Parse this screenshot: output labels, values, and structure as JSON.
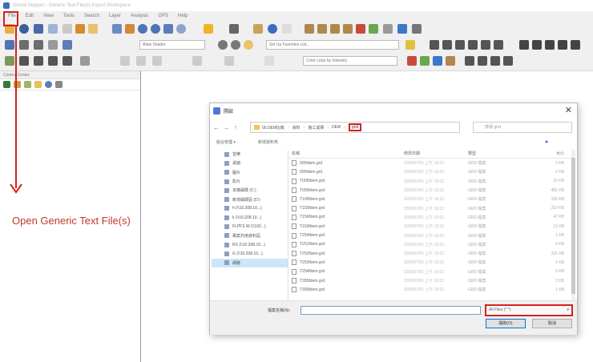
{
  "app": {
    "title": "Global Mapper - Generic Text File(s) Import Workspace"
  },
  "menu": [
    "File",
    "Edit",
    "View",
    "Tools",
    "Search",
    "Layer",
    "Analysis",
    "GPS",
    "Help"
  ],
  "toolbar": {
    "layer_combo": "Atlas Shader",
    "favorites_combo": "Set Up Favorites List...",
    "color_combo": "Color Lidar by Intensity"
  },
  "control_center": {
    "title": "Control Center"
  },
  "annotation": {
    "text": "Open Generic Text File(s)"
  },
  "dialog": {
    "title": "開啟",
    "breadcrumb": [
      "05.DEM比較",
      "資料",
      "施工成果",
      "DEM",
      "grid"
    ],
    "search_placeholder": "搜尋 grid",
    "organize_label": "組合管理 ▾",
    "new_folder_label": "新增資料夾",
    "nav_items": [
      "音樂",
      "桌面",
      "圖片",
      "影片",
      "本機磁碟 (C:)",
      "新增磁碟區 (D:)",
      "h (\\\\10.208.10...)",
      "k (\\\\10.208.10...)",
      "FLPFS W (\\\\192...)",
      "專案共用資料區",
      "RS (\\\\10.208.10...)",
      "G (\\\\10.208.10...)",
      "網路"
    ],
    "nav_selected_index": 12,
    "columns": [
      "名稱",
      "修改日期",
      "類型",
      "大小"
    ],
    "files": [
      {
        "name": "005fdem.grd",
        "date": "2020/07/01 上午 10:21",
        "type": "GRD 檔案",
        "size": "3 KB"
      },
      {
        "name": "005fdem.grd",
        "date": "2020/07/01 上午 10:21",
        "type": "GRD 檔案",
        "size": "5 KB"
      },
      {
        "name": "T005fdem.grd",
        "date": "2020/07/01 上午 10:21",
        "type": "GRD 檔案",
        "size": "32 KB"
      },
      {
        "name": "T055fdem.grd",
        "date": "2020/07/01 上午 10:21",
        "type": "GRD 檔案",
        "size": "481 KB"
      },
      {
        "name": "T105fdem.grd",
        "date": "2020/07/01 上午 10:21",
        "type": "GRD 檔案",
        "size": "150 KB"
      },
      {
        "name": "T155fdem.grd",
        "date": "2020/07/01 上午 10:21",
        "type": "GRD 檔案",
        "size": "253 KB"
      },
      {
        "name": "T156fdem.grd",
        "date": "2020/07/01 上午 10:21",
        "type": "GRD 檔案",
        "size": "47 KB"
      },
      {
        "name": "T153fdem.grd",
        "date": "2020/07/01 上午 10:21",
        "type": "GRD 檔案",
        "size": "12 KB"
      },
      {
        "name": "T254fdem.grd",
        "date": "2020/07/01 上午 10:21",
        "type": "GRD 檔案",
        "size": "1 KB"
      },
      {
        "name": "T251fdem.grd",
        "date": "2020/07/01 上午 10:21",
        "type": "GRD 檔案",
        "size": "9 KB"
      },
      {
        "name": "T252fdem.grd",
        "date": "2020/07/01 上午 10:21",
        "type": "GRD 檔案",
        "size": "231 KB"
      },
      {
        "name": "T253fdem.grd",
        "date": "2020/07/01 上午 10:21",
        "type": "GRD 檔案",
        "size": "3 KB"
      },
      {
        "name": "T254fdem.grd",
        "date": "2020/07/01 上午 10:21",
        "type": "GRD 檔案",
        "size": "6 KB"
      },
      {
        "name": "T355fdem.grd",
        "date": "2020/07/01 上午 10:21",
        "type": "GRD 檔案",
        "size": "3 KB"
      },
      {
        "name": "T356fdem.grd",
        "date": "2020/07/01 上午 10:21",
        "type": "GRD 檔案",
        "size": "1 KB"
      }
    ],
    "filename_label": "檔案名稱(N):",
    "filename_value": "",
    "filetype_value": "All Files (*.*)",
    "open_label": "開啟(O)",
    "cancel_label": "取消"
  }
}
